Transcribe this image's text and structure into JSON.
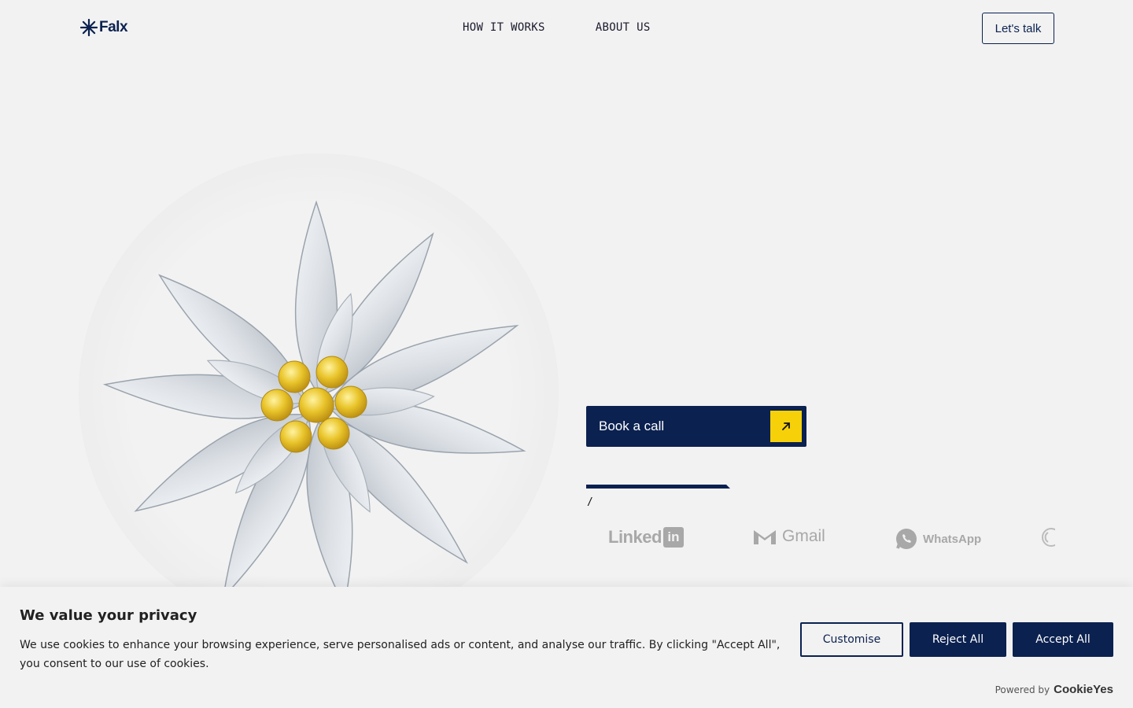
{
  "header": {
    "logo_text": "Falx",
    "nav": [
      "HOW IT WORKS",
      "ABOUT US"
    ],
    "cta_label": "Let's talk"
  },
  "hero": {
    "book_label": "Book a call",
    "slash": "/",
    "logos": [
      "Linked",
      "Gmail",
      "WhatsApp"
    ]
  },
  "cookie": {
    "title": "We value your privacy",
    "body": "We use cookies to enhance your browsing experience, serve personalised ads or content, and analyse our traffic. By clicking \"Accept All\", you consent to our use of cookies.",
    "customise": "Customise",
    "reject": "Reject All",
    "accept": "Accept All",
    "powered_by": "Powered by",
    "brand": "CookieYes"
  },
  "colors": {
    "navy": "#0b2150",
    "yellow": "#f6d10a",
    "background": "#f2f2f2"
  }
}
